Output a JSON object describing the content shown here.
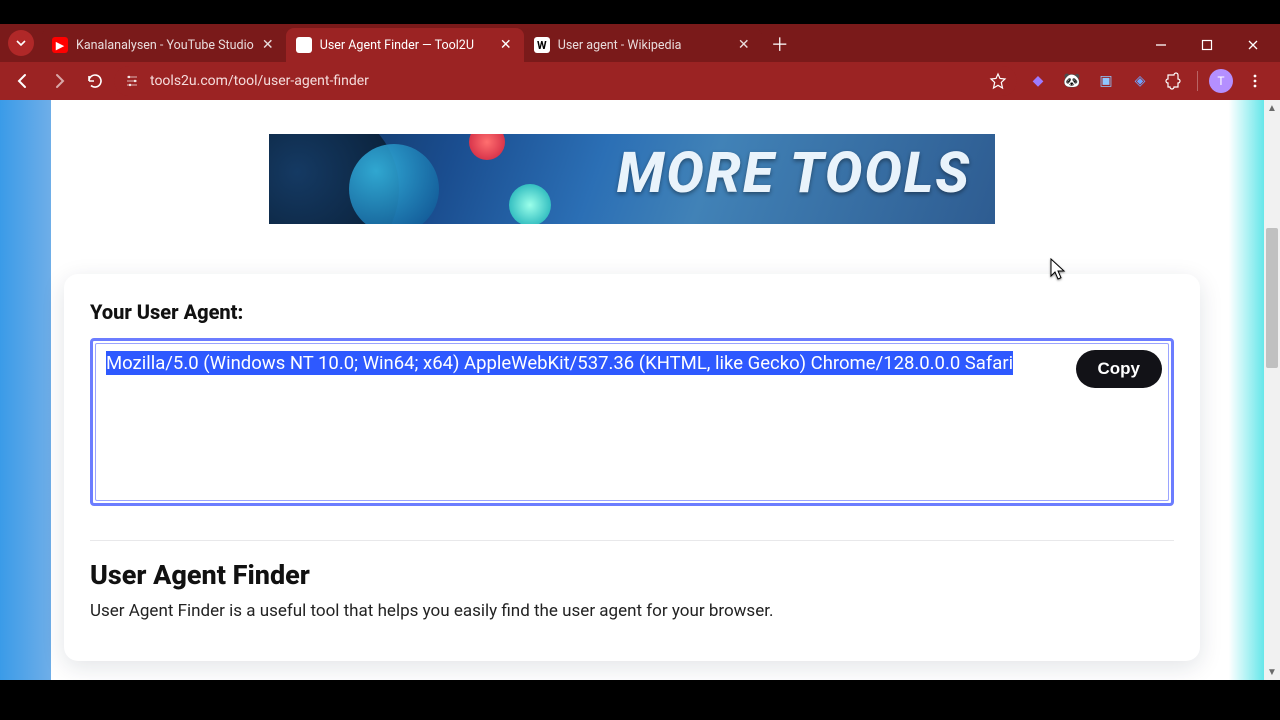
{
  "tabs": [
    {
      "title": "Kanalanalysen - YouTube Studio",
      "favicon": "youtube"
    },
    {
      "title": "User Agent Finder — Tool2U",
      "favicon": "blank"
    },
    {
      "title": "User agent - Wikipedia",
      "favicon": "wikipedia"
    }
  ],
  "url": "tools2u.com/tool/user-agent-finder",
  "profile_letter": "T",
  "banner_text": "MORE TOOLS",
  "card": {
    "label": "Your User Agent:",
    "ua": "Mozilla/5.0 (Windows NT 10.0; Win64; x64) AppleWebKit/537.36 (KHTML, like Gecko) Chrome/128.0.0.0 Safari",
    "copy": "Copy",
    "heading": "User Agent Finder",
    "description": "User Agent Finder is a useful tool that helps you easily find the user agent for your browser."
  }
}
